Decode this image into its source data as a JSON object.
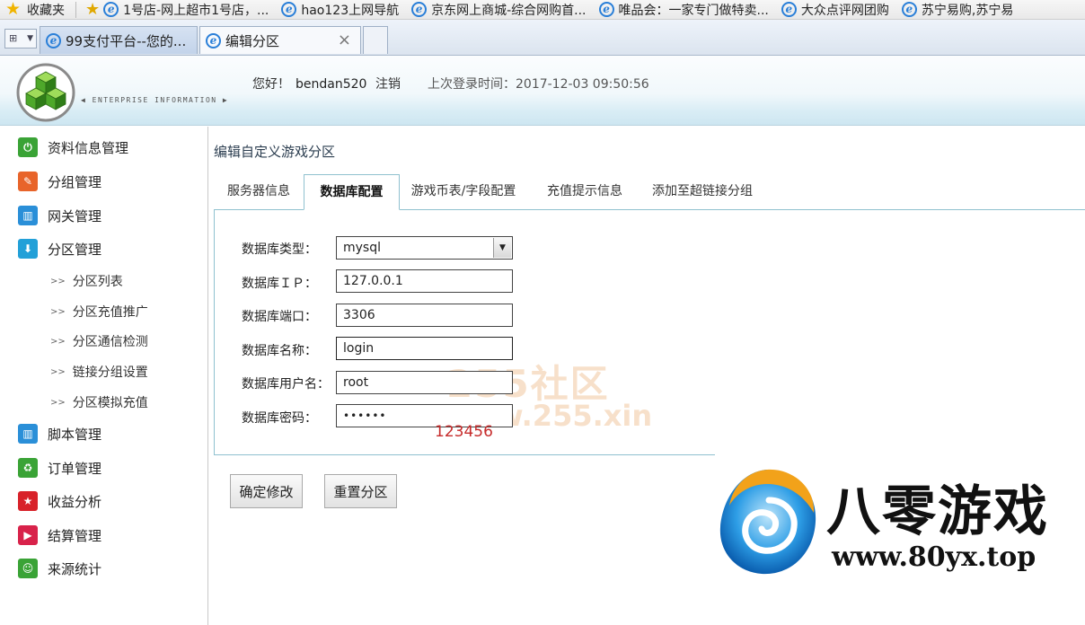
{
  "favorites_bar": {
    "label": "收藏夹",
    "items": [
      {
        "label": "1号店-网上超市1号店，..."
      },
      {
        "label": "hao123上网导航"
      },
      {
        "label": "京东网上商城-综合网购首..."
      },
      {
        "label": "唯品会：一家专门做特卖..."
      },
      {
        "label": "大众点评网团购"
      },
      {
        "label": "苏宁易购,苏宁易"
      }
    ]
  },
  "browser_tabs": [
    {
      "label": "99支付平台--您的..."
    },
    {
      "label": "编辑分区",
      "active": true
    }
  ],
  "header": {
    "logo_caption": "◀ ENTERPRISE INFORMATION ▶",
    "greeting": "您好！",
    "username": "bendan520",
    "logout": "注销",
    "last_login": "上次登录时间：2017-12-03 09:50:56"
  },
  "sidebar": {
    "items": [
      {
        "label": "资料信息管理",
        "icon": "power-icon",
        "color": "#3aa336"
      },
      {
        "label": "分组管理",
        "icon": "pencil-icon",
        "color": "#e8642a"
      },
      {
        "label": "网关管理",
        "icon": "grid-icon",
        "color": "#2a8fd8"
      },
      {
        "label": "分区管理",
        "icon": "download-icon",
        "color": "#22a0d8"
      },
      {
        "label": "脚本管理",
        "icon": "grid-icon",
        "color": "#2a8fd8"
      },
      {
        "label": "订单管理",
        "icon": "recycle-icon",
        "color": "#3aa336"
      },
      {
        "label": "收益分析",
        "icon": "star-icon",
        "color": "#d8222a"
      },
      {
        "label": "结算管理",
        "icon": "play-icon",
        "color": "#d8224a"
      },
      {
        "label": "来源统计",
        "icon": "smile-icon",
        "color": "#3aa336"
      }
    ],
    "sub_items": [
      {
        "label": "分区列表"
      },
      {
        "label": "分区充值推广"
      },
      {
        "label": "分区通信检测"
      },
      {
        "label": "链接分组设置"
      },
      {
        "label": "分区模拟充值"
      }
    ]
  },
  "main": {
    "heading": "编辑自定义游戏分区",
    "tabs": [
      {
        "label": "服务器信息"
      },
      {
        "label": "数据库配置",
        "active": true
      },
      {
        "label": "游戏币表/字段配置"
      },
      {
        "label": "充值提示信息"
      },
      {
        "label": "添加至超链接分组"
      }
    ],
    "form": {
      "db_type_label": "数据库类型：",
      "db_type_value": "mysql",
      "db_ip_label": "数据库ＩＰ：",
      "db_ip_value": "127.0.0.1",
      "db_port_label": "数据库端口：",
      "db_port_value": "3306",
      "db_name_label": "数据库名称：",
      "db_name_value": "login",
      "db_user_label": "数据库用户名：",
      "db_user_value": "root",
      "db_pass_label": "数据库密码：",
      "db_pass_value": "••••••",
      "db_pass_hint": "123456"
    },
    "buttons": {
      "confirm": "确定修改",
      "reset": "重置分区"
    }
  },
  "watermark": {
    "line1": "255社区",
    "line2": "www.255.xin"
  },
  "brand_overlay": {
    "name": "八零游戏",
    "url": "www.80yx.top"
  }
}
